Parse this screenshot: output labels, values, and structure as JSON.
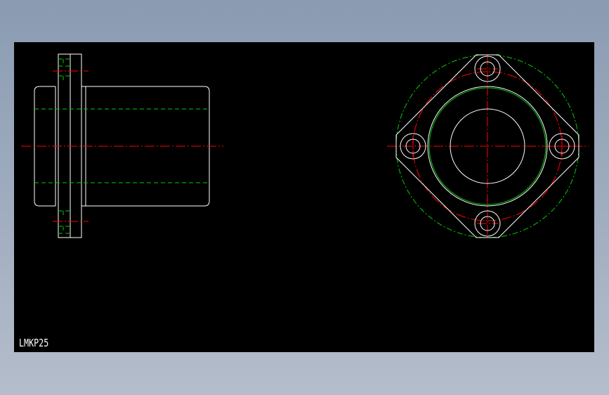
{
  "drawing": {
    "part_label": "LMKP25"
  },
  "colors": {
    "page_background_top": "#8a9bb2",
    "page_background_bottom": "#b4bdcb",
    "viewport_background": "#000000",
    "outline": "#ffffff",
    "hidden_line": "#00cc00",
    "center_line": "#ff0000"
  }
}
